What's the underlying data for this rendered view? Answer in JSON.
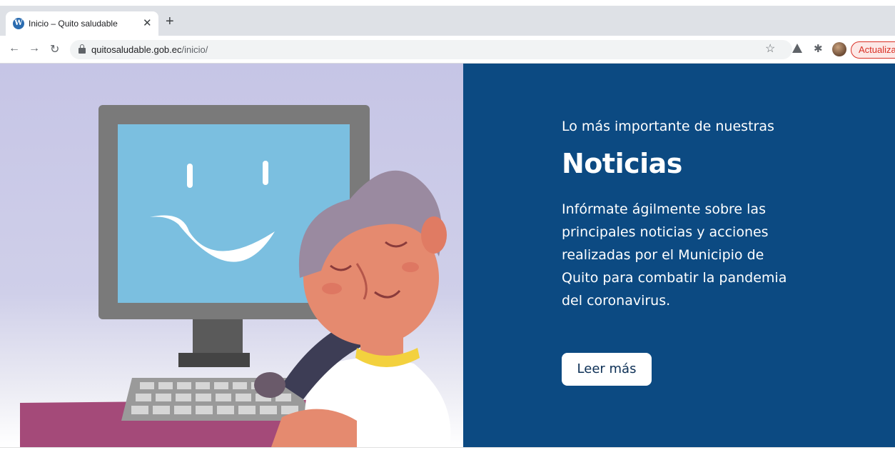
{
  "browser": {
    "tab": {
      "title": "Inicio – Quito saludable",
      "favicon": "wordpress-icon"
    },
    "toolbar": {
      "url_host": "quitosaludable.gob.ec",
      "url_path": "/inicio/",
      "update_label": "Actualizar"
    }
  },
  "hero": {
    "subtitle": "Lo más importante de nuestras",
    "title": "Noticias",
    "description": "Infórmate ágilmente sobre las principales noticias y acciones realizadas por el Municipio de Quito para combatir la pandemia del coronavirus.",
    "button_label": "Leer más"
  },
  "colors": {
    "panel_blue": "#0c4a82",
    "illustration_bg": "#c6c5e6",
    "update_red": "#d93025"
  }
}
